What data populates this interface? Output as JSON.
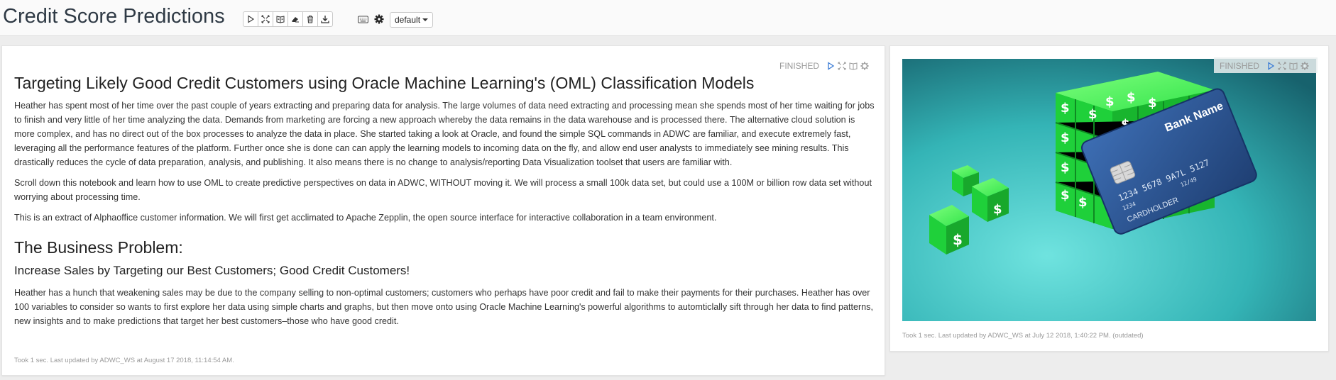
{
  "notebook": {
    "title": "Credit Score Predictions",
    "toolbar": {
      "buttons": [
        "run-all-icon",
        "show-hide-code-icon",
        "show-hide-output-icon",
        "clear-output-icon",
        "delete-icon",
        "export-icon"
      ],
      "extra": [
        "keyboard-icon",
        "settings-icon"
      ],
      "mode_label": "default"
    }
  },
  "paragraph_left": {
    "status": "FINISHED",
    "title": "Targeting Likely Good Credit Customers using Oracle Machine Learning's (OML) Classification Models",
    "p1": "Heather has spent most of her time over the past couple of years extracting and preparing data for analysis. The large volumes of data need extracting and processing mean she spends most of her time waiting for jobs to finish and very little of her time analyzing the data. Demands from marketing are forcing a new approach whereby the data remains in the data warehouse and is processed there. The alternative cloud solution is more complex, and has no direct out of the box processes to analyze the data in place. She started taking a look at Oracle, and found the simple SQL commands in ADWC are familiar, and execute extremely fast, leveraging all the performance features of the platform. Further once she is done can can apply the learning models to incoming data on the fly, and allow end user analysts to immediately see mining results. This drastically reduces the cycle of data preparation, analysis, and publishing. It also means there is no change to analysis/reporting Data Visualization toolset that users are familiar with.",
    "p2": "Scroll down this notebook and learn how to use OML to create predictive perspectives on data in ADWC, WITHOUT moving it. We will process a small 100k data set, but could use a 100M or billion row data set without worrying about processing time.",
    "p3": "This is an extract of Alphaoffice customer information. We will first get acclimated to Apache Zepplin, the open source interface for interactive collaboration in a team environment.",
    "h2": "The Business Problem:",
    "h3": "Increase Sales by Targeting our Best Customers; Good Credit Customers!",
    "p4": "Heather has a hunch that weakening sales may be due to the company selling to non-optimal customers; customers who perhaps have poor credit and fail to make their payments for their purchases. Heather has over 100 variables to consider so wants to first explore her data using simple charts and graphs, but then move onto using Oracle Machine Learning's powerful algorithms to automticlally sift through her data to find patterns, new insights and to make predictions that target her best customers–those who have good credit.",
    "footer": "Took 1 sec. Last updated by ADWC_WS at August 17 2018, 11:14:54 AM."
  },
  "paragraph_right": {
    "status": "FINISHED",
    "image": {
      "card_bank_name": "Bank Name",
      "card_number": "1234 5678 9A7L 5127",
      "card_small_number": "1234",
      "card_date": "12/49",
      "card_holder": "CARDHOLDER",
      "cube_symbol": "$"
    },
    "footer": "Took 1 sec. Last updated by ADWC_WS at July 12 2018, 1:40:22 PM. (outdated)"
  },
  "colors": {
    "header_bg": "#fafafa",
    "page_bg": "#ededed",
    "status_icon_blue": "#3a7bd5",
    "cube_green": "#22d63c",
    "card_blue": "#2f5b9c",
    "teal_bg": "#3ec5c7"
  }
}
